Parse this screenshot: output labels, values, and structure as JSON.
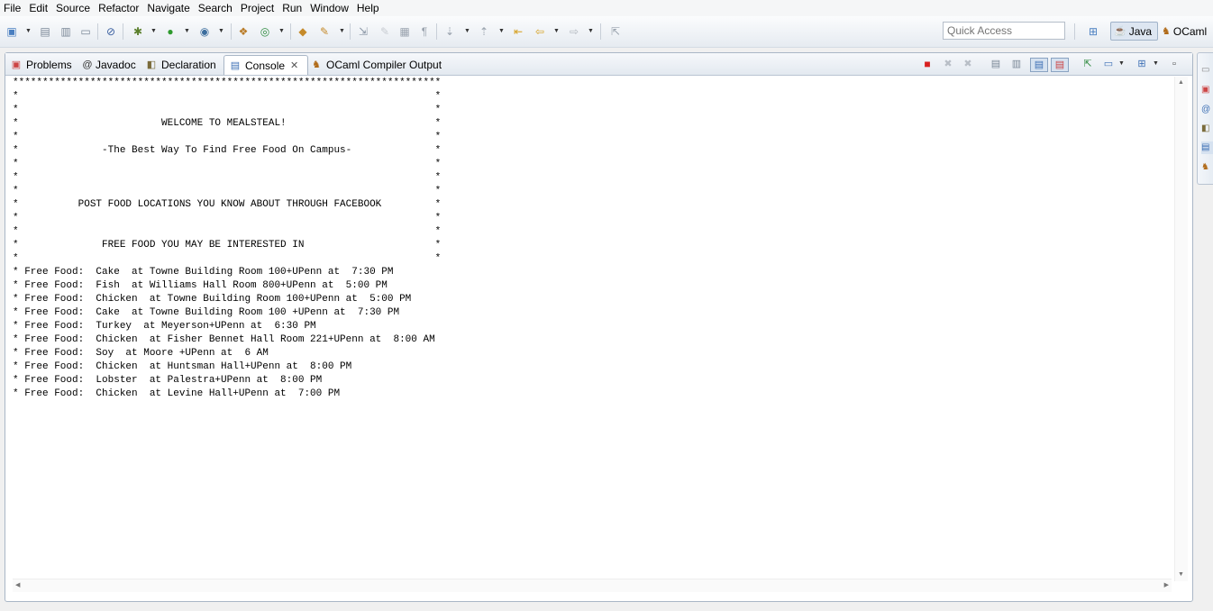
{
  "menu": [
    "File",
    "Edit",
    "Source",
    "Refactor",
    "Navigate",
    "Search",
    "Project",
    "Run",
    "Window",
    "Help"
  ],
  "quick_access": {
    "placeholder": "Quick Access"
  },
  "perspectives": [
    {
      "label": "Java"
    },
    {
      "label": "OCaml"
    }
  ],
  "tabs": [
    {
      "label": "Problems",
      "icon": "problems-icon"
    },
    {
      "label": "Javadoc",
      "icon": "at-icon"
    },
    {
      "label": "Declaration",
      "icon": "declaration-icon"
    },
    {
      "label": "Console",
      "icon": "console-icon",
      "active": true
    },
    {
      "label": "OCaml Compiler Output",
      "icon": "camel-icon"
    }
  ],
  "console": {
    "lines": [
      "************************************************************************",
      "*                                                                      *",
      "*                                                                      *",
      "*                        WELCOME TO MEALSTEAL!                         *",
      "*                                                                      *",
      "*              -The Best Way To Find Free Food On Campus-              *",
      "*                                                                      *",
      "*                                                                      *",
      "*                                                                      *",
      "*          POST FOOD LOCATIONS YOU KNOW ABOUT THROUGH FACEBOOK         *",
      "*                                                                      *",
      "*                                                                      *",
      "*              FREE FOOD YOU MAY BE INTERESTED IN                      *",
      "*                                                                      *",
      "* Free Food:  Cake  at Towne Building Room 100+UPenn at  7:30 PM",
      "* Free Food:  Fish  at Williams Hall Room 800+UPenn at  5:00 PM",
      "* Free Food:  Chicken  at Towne Building Room 100+UPenn at  5:00 PM",
      "* Free Food:  Cake  at Towne Building Room 100 +UPenn at  7:30 PM",
      "* Free Food:  Turkey  at Meyerson+UPenn at  6:30 PM",
      "* Free Food:  Chicken  at Fisher Bennet Hall Room 221+UPenn at  8:00 AM",
      "* Free Food:  Soy  at Moore +UPenn at  6 AM",
      "* Free Food:  Chicken  at Huntsman Hall+UPenn at  8:00 PM",
      "* Free Food:  Lobster  at Palestra+UPenn at  8:00 PM",
      "* Free Food:  Chicken  at Levine Hall+UPenn at  7:00 PM"
    ]
  },
  "colors": {
    "terminate": "#d82020",
    "accent": "#3c6fb4"
  },
  "icons": {
    "toolbar": [
      "new-icon",
      "save-icon",
      "save-all-icon",
      "print-icon",
      "toggle-breakpoints-icon",
      "debug-icon",
      "run-icon",
      "external-tools-icon",
      "new-java-package-icon",
      "new-java-class-icon",
      "open-type-icon",
      "search-icon",
      "next-annotation-icon",
      "previous-annotation-icon",
      "toggle-mark-icon",
      "block-selection-icon",
      "show-whitespace-icon",
      "next-edit-icon",
      "previous-edit-icon",
      "back-icon",
      "forward-icon",
      "pin-editor-icon"
    ],
    "view": [
      "terminate-icon",
      "remove-launch-icon",
      "remove-all-icon",
      "scroll-lock-icon",
      "word-wrap-icon",
      "show-on-stdout-icon",
      "show-on-stderr-icon",
      "pin-console-icon",
      "display-console-icon",
      "open-console-icon",
      "minimize-icon"
    ]
  }
}
